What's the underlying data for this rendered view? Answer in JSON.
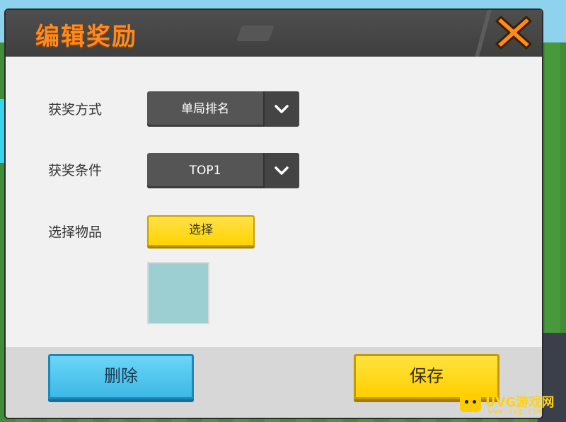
{
  "dialog": {
    "title": "编辑奖励",
    "close_icon": "close-x-icon"
  },
  "form": {
    "award_method": {
      "label": "获奖方式",
      "value": "单局排名"
    },
    "award_condition": {
      "label": "获奖条件",
      "value": "TOP1"
    },
    "select_item": {
      "label": "选择物品",
      "button_label": "选择"
    }
  },
  "footer": {
    "delete_label": "删除",
    "save_label": "保存"
  },
  "watermark": {
    "text": "UVG游戏网",
    "subtext": "www.uvg.com"
  },
  "colors": {
    "title_orange": "#ff8a1e",
    "header_dark": "#444444",
    "yellow_button": "#ffd400",
    "blue_button": "#3cb8e6",
    "item_slot": "#9ccfd1"
  }
}
